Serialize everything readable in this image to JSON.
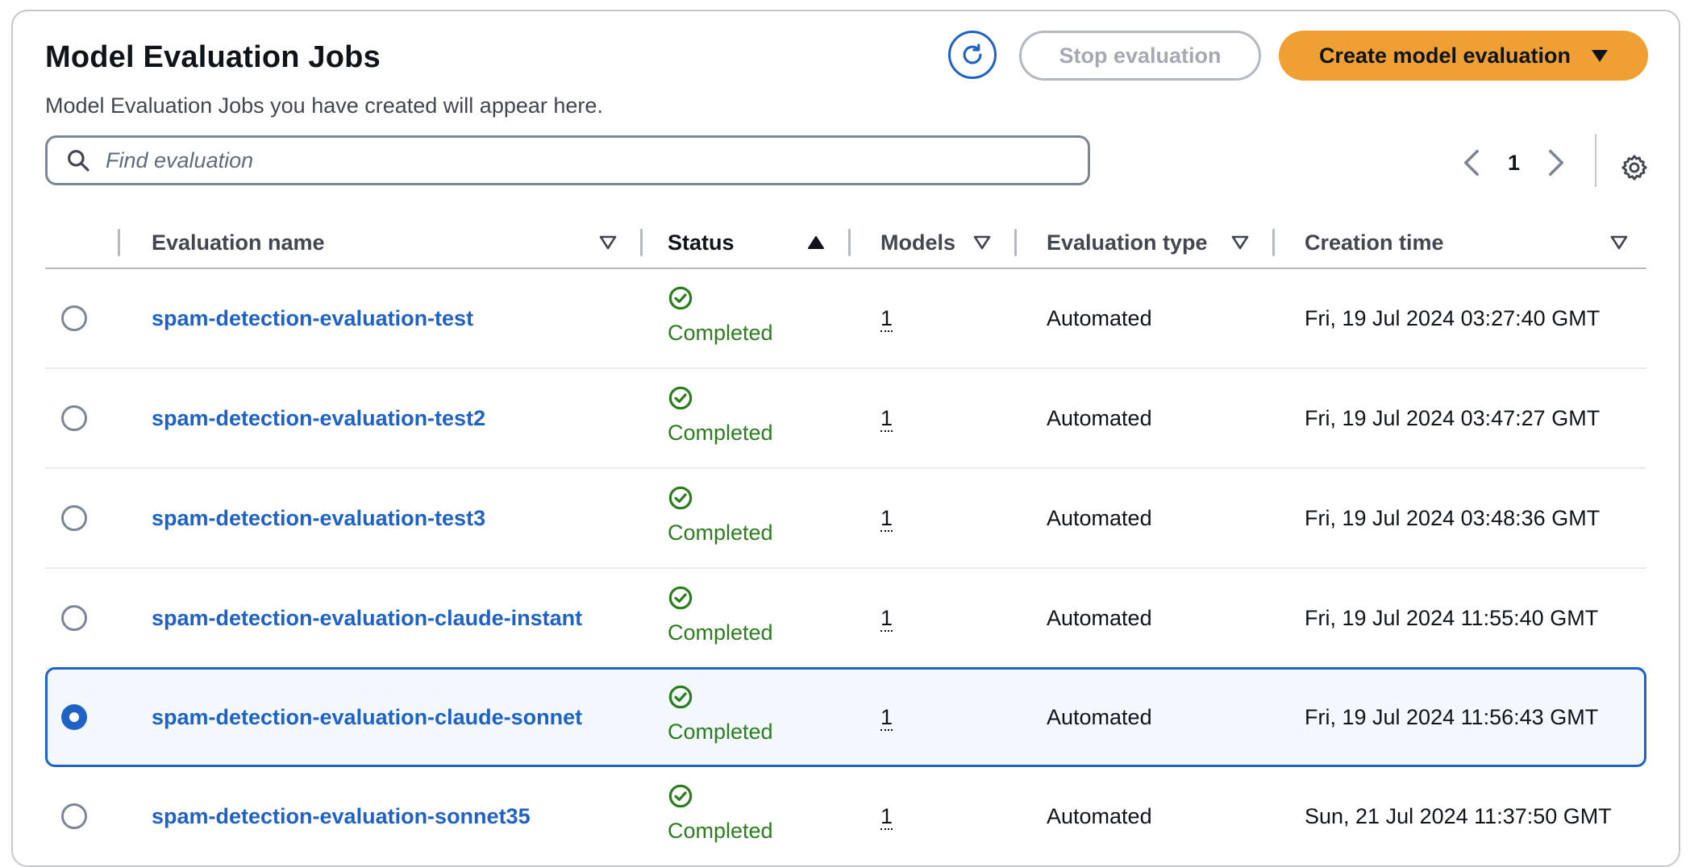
{
  "header": {
    "title": "Model Evaluation Jobs",
    "subtitle": "Model Evaluation Jobs you have created will appear here.",
    "stop_label": "Stop evaluation",
    "create_label": "Create model evaluation"
  },
  "search": {
    "placeholder": "Find evaluation"
  },
  "pagination": {
    "current_page": "1"
  },
  "table": {
    "columns": {
      "name": "Evaluation name",
      "status": "Status",
      "models": "Models",
      "type": "Evaluation type",
      "time": "Creation time"
    },
    "rows": [
      {
        "name": "spam-detection-evaluation-test",
        "status": "Completed",
        "models": "1",
        "type": "Automated",
        "time": "Fri, 19 Jul 2024 03:27:40 GMT",
        "selected": false
      },
      {
        "name": "spam-detection-evaluation-test2",
        "status": "Completed",
        "models": "1",
        "type": "Automated",
        "time": "Fri, 19 Jul 2024 03:47:27 GMT",
        "selected": false
      },
      {
        "name": "spam-detection-evaluation-test3",
        "status": "Completed",
        "models": "1",
        "type": "Automated",
        "time": "Fri, 19 Jul 2024 03:48:36 GMT",
        "selected": false
      },
      {
        "name": "spam-detection-evaluation-claude-instant",
        "status": "Completed",
        "models": "1",
        "type": "Automated",
        "time": "Fri, 19 Jul 2024 11:55:40 GMT",
        "selected": false
      },
      {
        "name": "spam-detection-evaluation-claude-sonnet",
        "status": "Completed",
        "models": "1",
        "type": "Automated",
        "time": "Fri, 19 Jul 2024 11:56:43 GMT",
        "selected": true
      },
      {
        "name": "spam-detection-evaluation-sonnet35",
        "status": "Completed",
        "models": "1",
        "type": "Automated",
        "time": "Sun, 21 Jul 2024 11:37:50 GMT",
        "selected": false
      }
    ]
  },
  "colors": {
    "accent": "#1f62c6",
    "primary_button": "#f0a033",
    "success": "#2c7d1e"
  },
  "icons": {
    "refresh": "refresh-icon",
    "search": "search-icon",
    "prev": "chevron-left-icon",
    "next": "chevron-right-icon",
    "settings": "gear-icon",
    "status": "check-circle-icon"
  }
}
